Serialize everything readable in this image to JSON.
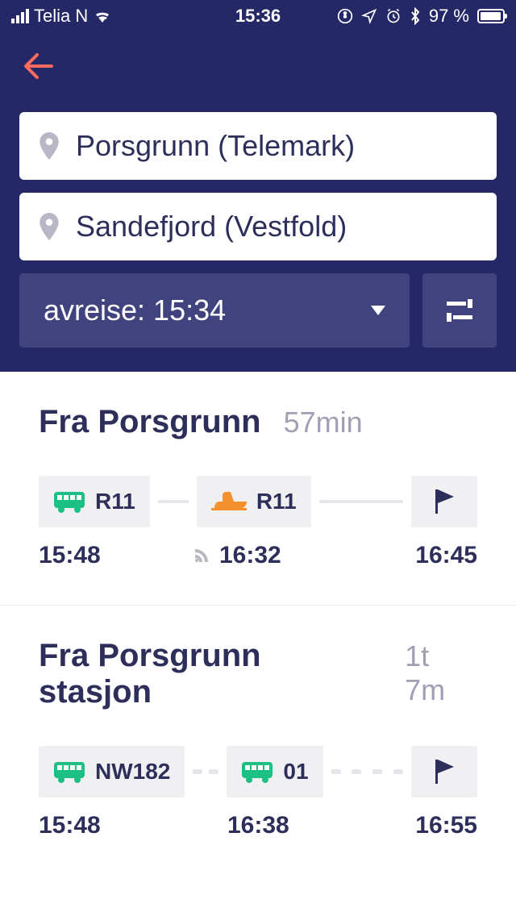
{
  "status_bar": {
    "carrier": "Telia N",
    "time": "15:36",
    "battery_pct": "97 %"
  },
  "header": {
    "from": "Porsgrunn (Telemark)",
    "to": "Sandefjord (Vestfold)",
    "departure_label": "avreise: 15:34"
  },
  "results": [
    {
      "title": "Fra Porsgrunn",
      "duration": "57min",
      "segments": [
        {
          "mode": "bus",
          "route": "R11",
          "color": "#1cbf84"
        },
        {
          "mode": "train",
          "route": "R11",
          "color": "#f4902d"
        }
      ],
      "times": {
        "start": "15:48",
        "mid": "16:32",
        "mid_has_rss": true,
        "end": "16:45"
      },
      "connector_style": "solid"
    },
    {
      "title": "Fra Porsgrunn stasjon",
      "duration": "1t 7m",
      "segments": [
        {
          "mode": "bus",
          "route": "NW182",
          "color": "#1cbf84"
        },
        {
          "mode": "bus",
          "route": "01",
          "color": "#1cbf84"
        }
      ],
      "times": {
        "start": "15:48",
        "mid": "16:38",
        "mid_has_rss": false,
        "end": "16:55"
      },
      "connector_style": "dashed"
    }
  ]
}
